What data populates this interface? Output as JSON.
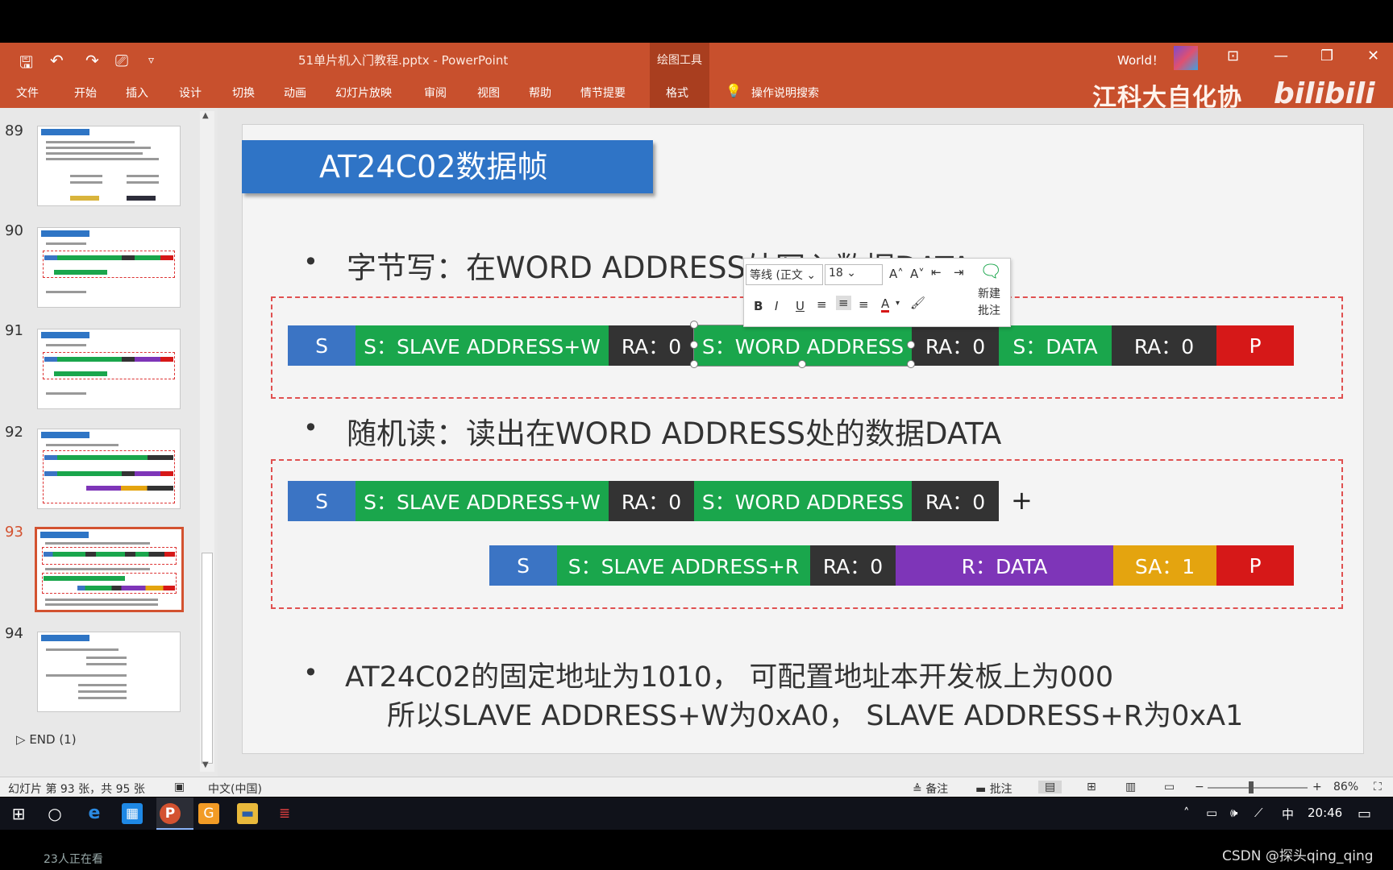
{
  "window": {
    "quick_access": {
      "save": "🖫",
      "undo": "↶",
      "redo": "↷",
      "present": "⎚",
      "more": "▿"
    },
    "doc_title": "51单片机入门教程.pptx  -  PowerPoint",
    "tool_group": "绘图工具",
    "user_name": "World！",
    "watermark_text": "江科大自化协",
    "bili_logo": "bilibili",
    "controls": {
      "ribbon_opts": "⊡",
      "minimize": "—",
      "restore": "❐",
      "close": "✕"
    }
  },
  "ribbon": {
    "tabs": [
      "文件",
      "开始",
      "插入",
      "设计",
      "切换",
      "动画",
      "幻灯片放映",
      "审阅",
      "视图",
      "帮助",
      "情节提要",
      "格式"
    ],
    "search_label": "操作说明搜索"
  },
  "thumbnails": [
    {
      "num": "89"
    },
    {
      "num": "90"
    },
    {
      "num": "91"
    },
    {
      "num": "92"
    },
    {
      "num": "93"
    },
    {
      "num": "94"
    }
  ],
  "end_section": "END (1)",
  "slide": {
    "title": "AT24C02数据帧",
    "bullet1": "字节写：在WORD ADDRESS处写入数据DATA",
    "bullet2": "随机读：读出在WORD ADDRESS处的数据DATA",
    "bullet3_line1": "AT24C02的固定地址为1010， 可配置地址本开发板上为000",
    "bullet3_line2": "所以SLAVE ADDRESS+W为0xA0， SLAVE ADDRESS+R为0xA1",
    "bullet_mark": "•",
    "plus": "+",
    "frame_write": [
      "S",
      "S：SLAVE ADDRESS+W",
      "RA：0",
      "S：WORD ADDRESS",
      "RA：0",
      "S：DATA",
      "RA：0",
      "P"
    ],
    "frame_read1": [
      "S",
      "S：SLAVE ADDRESS+W",
      "RA：0",
      "S：WORD ADDRESS",
      "RA：0"
    ],
    "frame_read2": [
      "S",
      "S：SLAVE ADDRESS+R",
      "RA：0",
      "R：DATA",
      "SA：1",
      "P"
    ]
  },
  "mini_toolbar": {
    "font": "等线 (正文",
    "size": "18",
    "grow": "A˄",
    "shrink": "A˅",
    "bold": "B",
    "italic": "I",
    "underline": "U",
    "font_color": "A",
    "new_comment": "新建",
    "comment": "批注"
  },
  "status": {
    "slide_info": "幻灯片 第 93 张，共 95 张",
    "language": "中文(中国)",
    "notes": "备注",
    "comments": "批注",
    "zoom": "86%"
  },
  "taskbar": {
    "ime": "中",
    "time": "20:46"
  },
  "overlay": {
    "viewers": "23人正在看",
    "csdn": "CSDN @探头qing_qing"
  },
  "colors": {
    "ribbon": "#c8502d",
    "start": "#3b74c4",
    "address": "#1aa64c",
    "ack": "#333333",
    "stop": "#d61818",
    "data_read": "#7e35b8",
    "nack": "#e4a40f"
  }
}
